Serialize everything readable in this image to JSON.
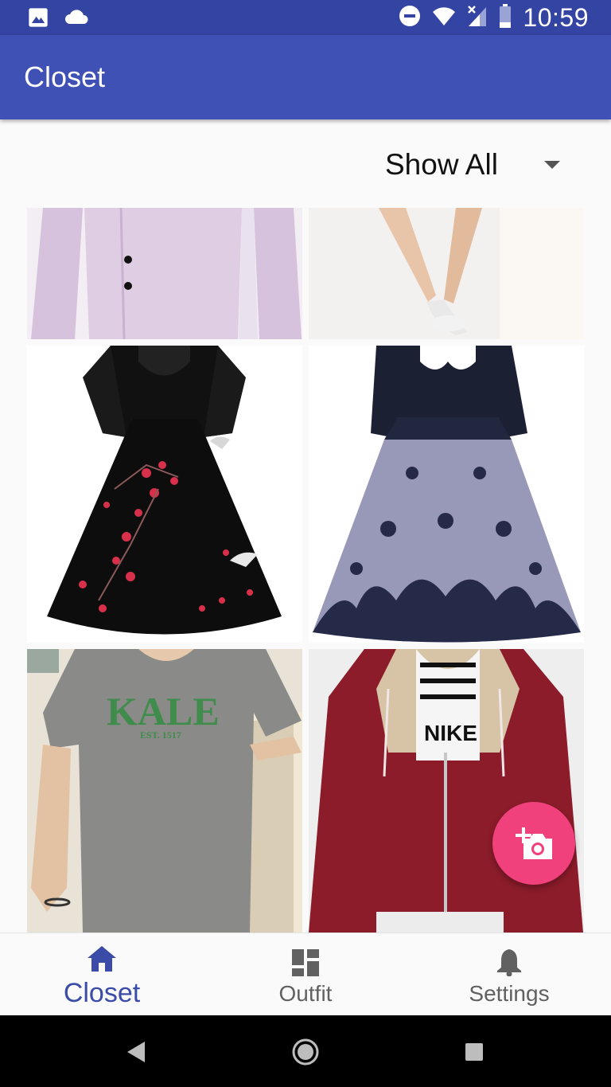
{
  "status_bar": {
    "time": "10:59",
    "icons_left": [
      "image-icon",
      "cloud-icon"
    ],
    "icons_right": [
      "do-not-disturb-icon",
      "wifi-icon",
      "signal-icon",
      "battery-icon"
    ]
  },
  "app_bar": {
    "title": "Closet"
  },
  "filter": {
    "selected": "Show All"
  },
  "grid": {
    "items": [
      {
        "name": "pink-dress-shirt"
      },
      {
        "name": "skirt-legs-sneakers"
      },
      {
        "name": "black-floral-dress"
      },
      {
        "name": "navy-lace-dress"
      },
      {
        "name": "gray-yale-tshirt",
        "print": "KALE",
        "sub": "EST. 1517"
      },
      {
        "name": "red-hoodie",
        "print": "NIKE"
      }
    ]
  },
  "fab": {
    "icon": "add-photo-icon"
  },
  "bottom_nav": {
    "items": [
      {
        "label": "Closet",
        "icon": "home-icon",
        "active": true
      },
      {
        "label": "Outfit",
        "icon": "dashboard-icon",
        "active": false
      },
      {
        "label": "Settings",
        "icon": "bell-icon",
        "active": false
      }
    ]
  },
  "system_nav": {
    "icons": [
      "back-icon",
      "home-circle-icon",
      "recents-icon"
    ]
  },
  "colors": {
    "primary": "#3f51b5",
    "primary_dark": "#3444a3",
    "accent": "#f0417d",
    "nav_active": "#3b4ba8",
    "nav_inactive": "#616161"
  }
}
